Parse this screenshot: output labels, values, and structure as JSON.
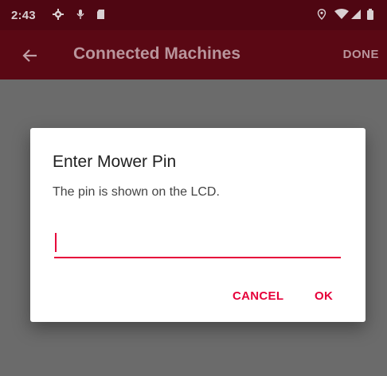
{
  "status_bar": {
    "time": "2:43",
    "icons": [
      "gear-icon",
      "mic-icon",
      "sd-card-icon",
      "location-icon",
      "wifi-icon",
      "signal-icon",
      "battery-icon"
    ]
  },
  "app_bar": {
    "title": "Connected Machines",
    "done_label": "DONE",
    "back_icon": "back-arrow-icon"
  },
  "dialog": {
    "title": "Enter Mower Pin",
    "message": "The pin is shown on the LCD.",
    "pin_value": "",
    "cancel_label": "CANCEL",
    "ok_label": "OK"
  },
  "colors": {
    "status_bar": "#4f0612",
    "app_bar": "#5a0814",
    "scrim": "#6b6b6b",
    "accent": "#e6003a"
  }
}
